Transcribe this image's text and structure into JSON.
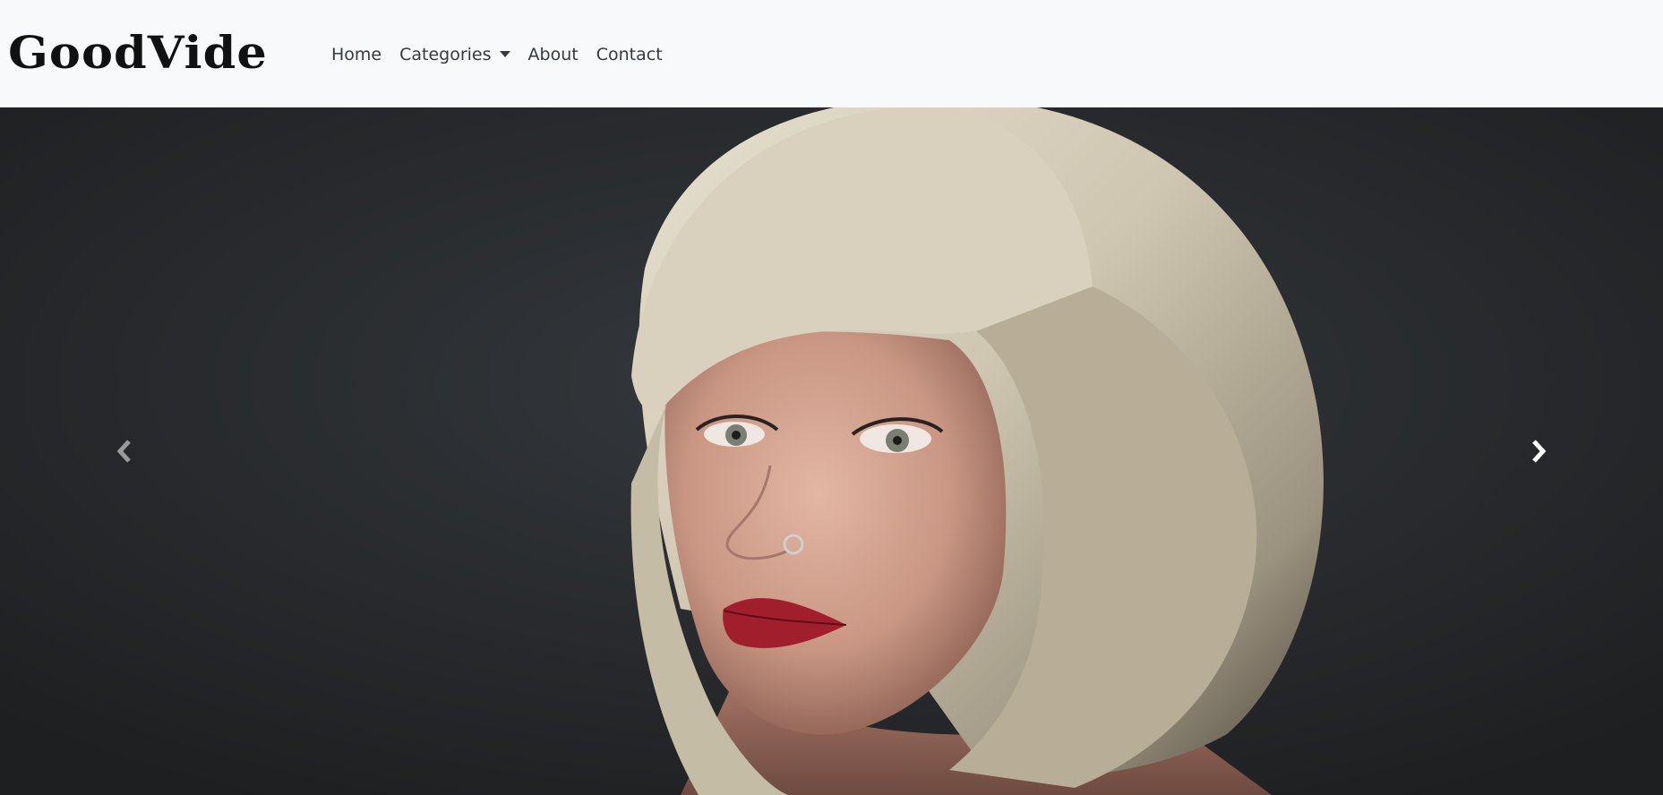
{
  "brand": {
    "name": "GoodVide"
  },
  "nav": {
    "home": "Home",
    "categories": "Categories",
    "about": "About",
    "contact": "Contact"
  },
  "carousel": {
    "image": "portrait-photo",
    "prev_icon": "chevron-left-icon",
    "next_icon": "chevron-right-icon"
  },
  "colors": {
    "navbar_bg": "#f8f9fa",
    "nav_text": "#343a40",
    "slide_bg": "#26292c"
  }
}
